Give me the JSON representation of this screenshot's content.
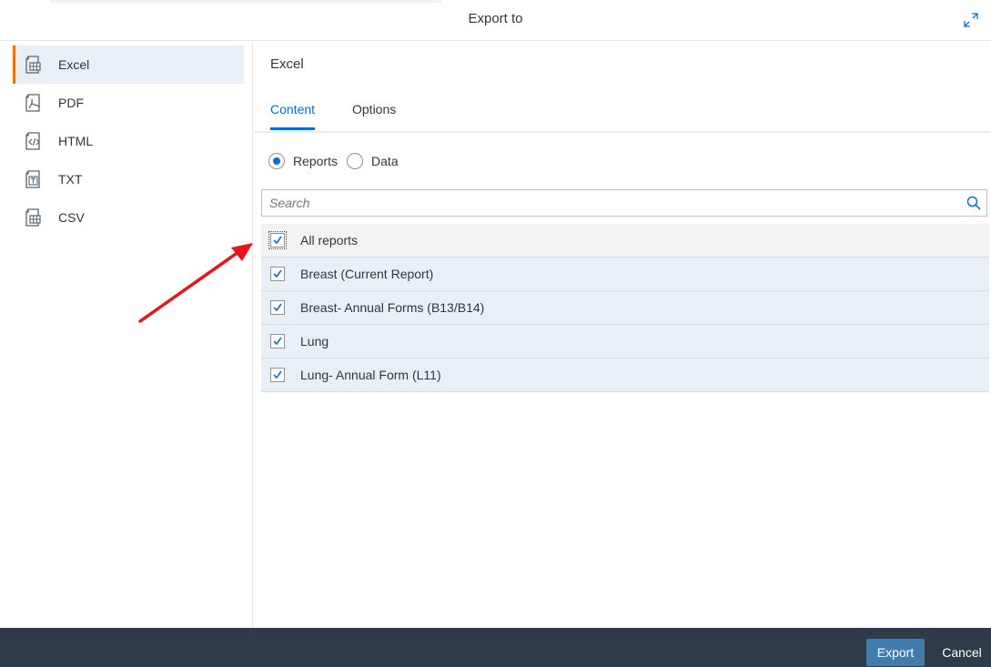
{
  "dialog": {
    "title": "Export to"
  },
  "sidebar": {
    "items": [
      {
        "label": "Excel",
        "icon": "excel-file-icon",
        "selected": true
      },
      {
        "label": "PDF",
        "icon": "pdf-file-icon",
        "selected": false
      },
      {
        "label": "HTML",
        "icon": "html-file-icon",
        "selected": false
      },
      {
        "label": "TXT",
        "icon": "txt-file-icon",
        "selected": false
      },
      {
        "label": "CSV",
        "icon": "csv-file-icon",
        "selected": false
      }
    ]
  },
  "main": {
    "title": "Excel",
    "tabs": [
      {
        "label": "Content",
        "active": true
      },
      {
        "label": "Options",
        "active": false
      }
    ],
    "scope": {
      "options": [
        {
          "label": "Reports",
          "selected": true
        },
        {
          "label": "Data",
          "selected": false
        }
      ]
    },
    "search": {
      "placeholder": "Search",
      "value": ""
    },
    "reports": {
      "all_label": "All reports",
      "all_checked": true,
      "items": [
        {
          "label": "Breast (Current Report)",
          "checked": true
        },
        {
          "label": "Breast- Annual Forms (B13/B14)",
          "checked": true
        },
        {
          "label": "Lung",
          "checked": true
        },
        {
          "label": "Lung- Annual Form (L11)",
          "checked": true
        }
      ]
    }
  },
  "footer": {
    "export_label": "Export",
    "cancel_label": "Cancel"
  },
  "annotation": {
    "arrow_color": "#e8141c",
    "target": "All reports checkbox"
  },
  "colors": {
    "accent": "#0a6ed1",
    "selected_marker": "#e9730c",
    "footer_bg": "#2f3c48",
    "export_button": "#427cac",
    "row_bg": "#e8eff6"
  }
}
